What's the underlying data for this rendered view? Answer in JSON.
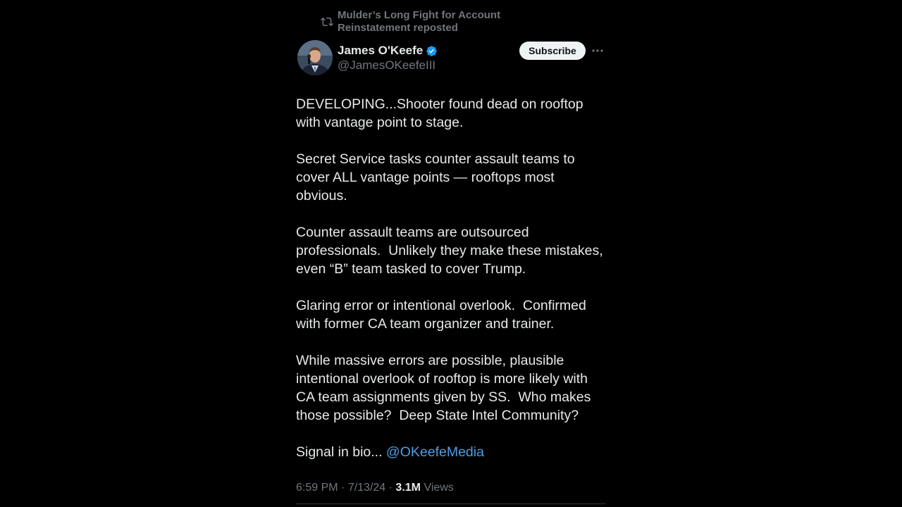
{
  "repost": {
    "icon": "repost-icon",
    "text": "Mulder’s Long Fight for Account Reinstatement reposted"
  },
  "author": {
    "name": "James O'Keefe",
    "handle": "@JamesOKeefeIII",
    "verified_icon": "verified-badge-icon",
    "verified_color": "#1d9bf0"
  },
  "actions": {
    "subscribe_label": "Subscribe",
    "more_icon": "more-options-icon"
  },
  "tweet": {
    "paragraphs": [
      "DEVELOPING...Shooter found dead on rooftop with vantage point to stage.",
      "Secret Service tasks counter assault teams to cover ALL vantage points — rooftops most obvious.",
      "Counter assault teams are outsourced professionals.  Unlikely they make these mistakes, even “B” team tasked to cover Trump.",
      "Glaring error or intentional overlook.  Confirmed with former CA team organizer and trainer.",
      "While massive errors are possible, plausible intentional overlook of rooftop is more likely with CA team assignments given by SS.  Who makes those possible?  Deep State Intel Community?"
    ],
    "last_prefix": "Signal in bio... ",
    "mention": "@OKeefeMedia",
    "mention_color": "#4f9de6"
  },
  "meta": {
    "time": "6:59 PM",
    "separator": " · ",
    "date": "7/13/24",
    "views_count": "3.1M",
    "views_label": " Views"
  }
}
